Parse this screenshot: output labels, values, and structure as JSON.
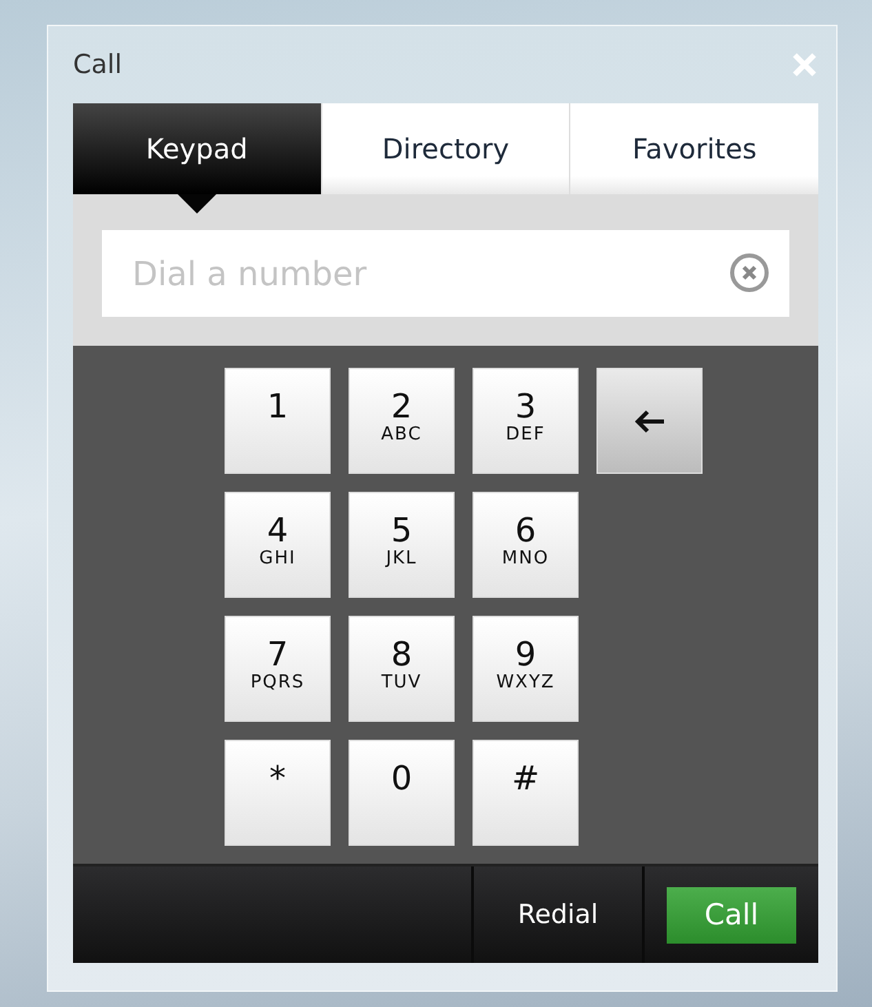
{
  "window": {
    "title": "Call"
  },
  "tabs": [
    {
      "label": "Keypad",
      "selected": true
    },
    {
      "label": "Directory",
      "selected": false
    },
    {
      "label": "Favorites",
      "selected": false
    }
  ],
  "dial_field": {
    "placeholder": "Dial a number"
  },
  "keys": [
    {
      "kind": "digit",
      "digit": "1"
    },
    {
      "kind": "digit",
      "digit": "2",
      "letters": "ABC"
    },
    {
      "kind": "digit",
      "digit": "3",
      "letters": "DEF"
    },
    {
      "kind": "backspace"
    },
    {
      "kind": "digit",
      "digit": "4",
      "letters": "GHI"
    },
    {
      "kind": "digit",
      "digit": "5",
      "letters": "JKL"
    },
    {
      "kind": "digit",
      "digit": "6",
      "letters": "MNO"
    },
    {
      "kind": "digit",
      "digit": "7",
      "letters": "PQRS"
    },
    {
      "kind": "digit",
      "digit": "8",
      "letters": "TUV"
    },
    {
      "kind": "digit",
      "digit": "9",
      "letters": "WXYZ"
    },
    {
      "kind": "digit",
      "digit": "*"
    },
    {
      "kind": "digit",
      "digit": "0"
    },
    {
      "kind": "digit",
      "digit": "#"
    }
  ],
  "buttons": [
    {
      "label": "Redial",
      "kind": "plain"
    },
    {
      "label": "Call",
      "kind": "primary"
    }
  ]
}
